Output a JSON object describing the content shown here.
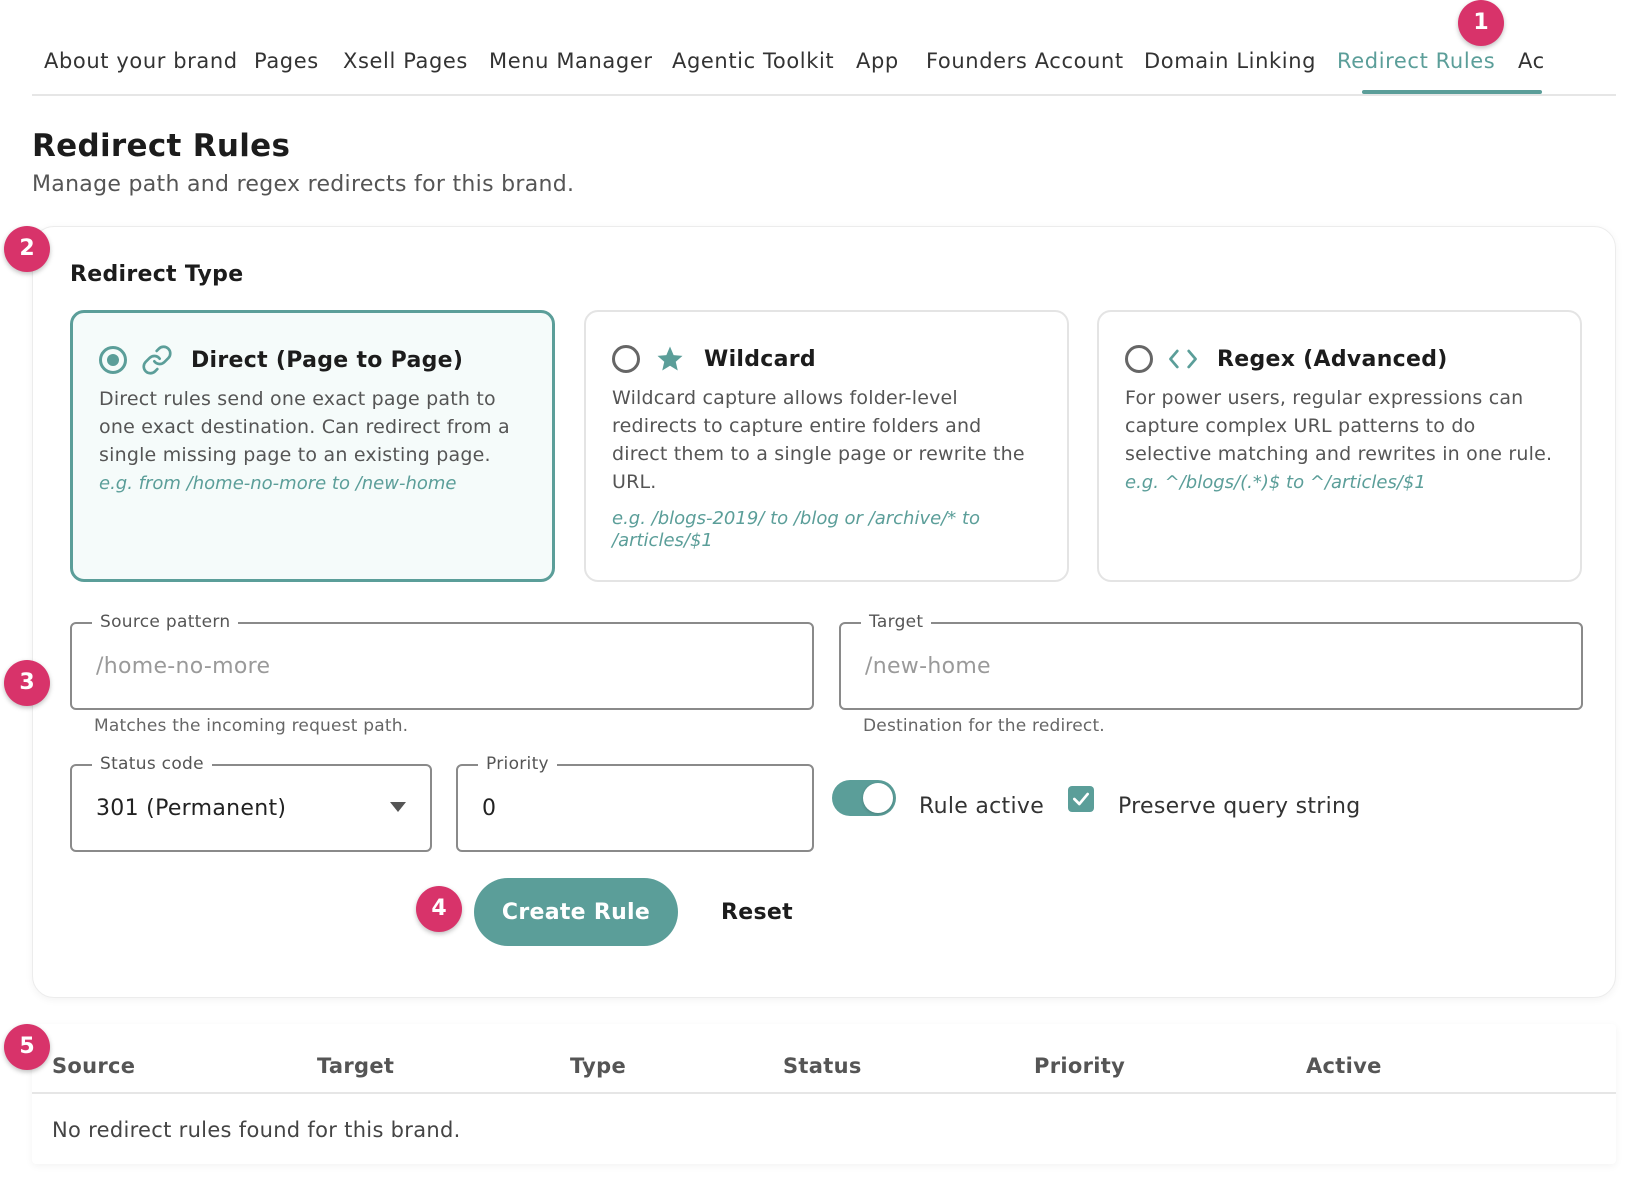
{
  "tabs": [
    {
      "label": "About your brand",
      "active": false
    },
    {
      "label": "Pages",
      "active": false
    },
    {
      "label": "Xsell Pages",
      "active": false
    },
    {
      "label": "Menu Manager",
      "active": false
    },
    {
      "label": "Agentic Toolkit",
      "active": false
    },
    {
      "label": "App",
      "active": false
    },
    {
      "label": "Founders Account",
      "active": false
    },
    {
      "label": "Domain Linking",
      "active": false
    },
    {
      "label": "Redirect Rules",
      "active": true
    },
    {
      "label": "Ac",
      "active": false
    }
  ],
  "markers": [
    "1",
    "2",
    "3",
    "4",
    "5"
  ],
  "page": {
    "title": "Redirect Rules",
    "subtitle": "Manage path and regex redirects for this brand."
  },
  "redirect_type": {
    "title": "Redirect Type",
    "options": [
      {
        "title": "Direct (Page to Page)",
        "icon": "link-icon",
        "selected": true,
        "description": "Direct rules send one exact page path to one exact destination. Can redirect from a single missing page to an existing page.",
        "example": "e.g. from /home-no-more to /new-home"
      },
      {
        "title": "Wildcard",
        "icon": "star-icon",
        "selected": false,
        "description": "Wildcard capture allows folder-level redirects to capture entire folders and direct them to a single page or rewrite the URL.",
        "example": "e.g. /blogs-2019/ to /blog or /archive/* to /articles/$1"
      },
      {
        "title": "Regex (Advanced)",
        "icon": "code-brackets-icon",
        "selected": false,
        "description": "For power users, regular expressions can capture complex URL patterns to do selective matching and rewrites in one rule.",
        "example": "e.g. ^/blogs/(.*)$ to ^/articles/$1"
      }
    ]
  },
  "form": {
    "source": {
      "label": "Source pattern",
      "placeholder": "/home-no-more",
      "helper": "Matches the incoming request path."
    },
    "target": {
      "label": "Target",
      "placeholder": "/new-home",
      "helper": "Destination for the redirect."
    },
    "status": {
      "label": "Status code",
      "value": "301 (Permanent)"
    },
    "priority": {
      "label": "Priority",
      "value": "0"
    },
    "rule_active": {
      "label": "Rule active",
      "on": true
    },
    "preserve_query": {
      "label": "Preserve query string",
      "checked": true
    },
    "create_label": "Create Rule",
    "reset_label": "Reset"
  },
  "table": {
    "headers": [
      "Source",
      "Target",
      "Type",
      "Status",
      "Priority",
      "Active"
    ],
    "empty_text": "No redirect rules found for this brand."
  },
  "colors": {
    "accent": "#5b9e99",
    "marker": "#d8336a"
  }
}
